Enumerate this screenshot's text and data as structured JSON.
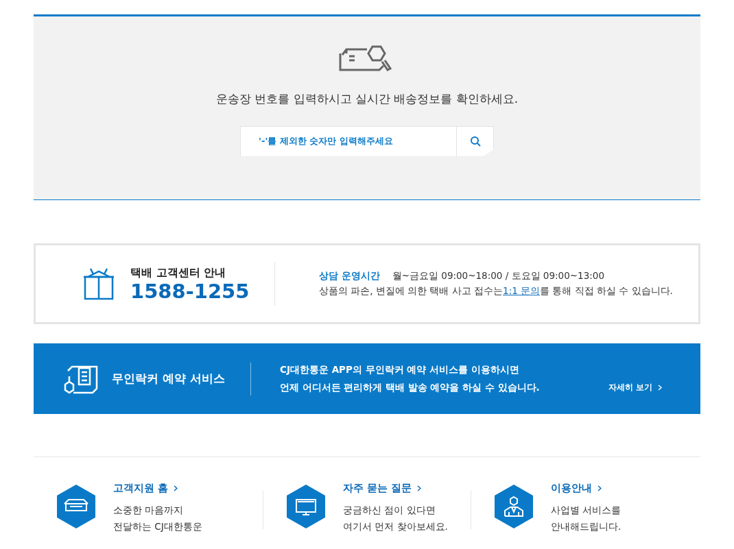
{
  "tracking": {
    "message": "운송장 번호를 입력하시고 실시간 배송정보를 확인하세요.",
    "placeholder": "'-'를 제외한 숫자만 입력해주세요"
  },
  "customer_center": {
    "title": "택배 고객센터 안내",
    "phone": "1588-1255",
    "hours_label": "상담 운영시간",
    "hours": "월~금요일 09:00~18:00 / 토요일 09:00~13:00",
    "notice_before": "상품의 파손, 변질에 의한 택배 사고 접수는",
    "notice_link": "1:1 문의",
    "notice_after": "를 통해 직접 하실 수 있습니다."
  },
  "locker_banner": {
    "title": "무인락커 예약 서비스",
    "description": [
      "CJ대한통운 APP의 무인락커 예약 서비스를 이용하시면",
      "언제 어디서든 편리하게 택배 발송 예약을 하실 수 있습니다."
    ],
    "more_link": "자세히 보기"
  },
  "quick_links": [
    {
      "kind": "home",
      "title": "고객지원 홈",
      "description": [
        "소중한 마음까지",
        "전달하는 CJ대한통운"
      ]
    },
    {
      "kind": "faq",
      "title": "자주 묻는 질문",
      "description": [
        "궁금하신 점이 있다면",
        "여기서 먼저 찾아보세요."
      ]
    },
    {
      "kind": "guide",
      "title": "이용안내",
      "description": [
        "사업별 서비스를",
        "안내해드립니다."
      ]
    }
  ]
}
